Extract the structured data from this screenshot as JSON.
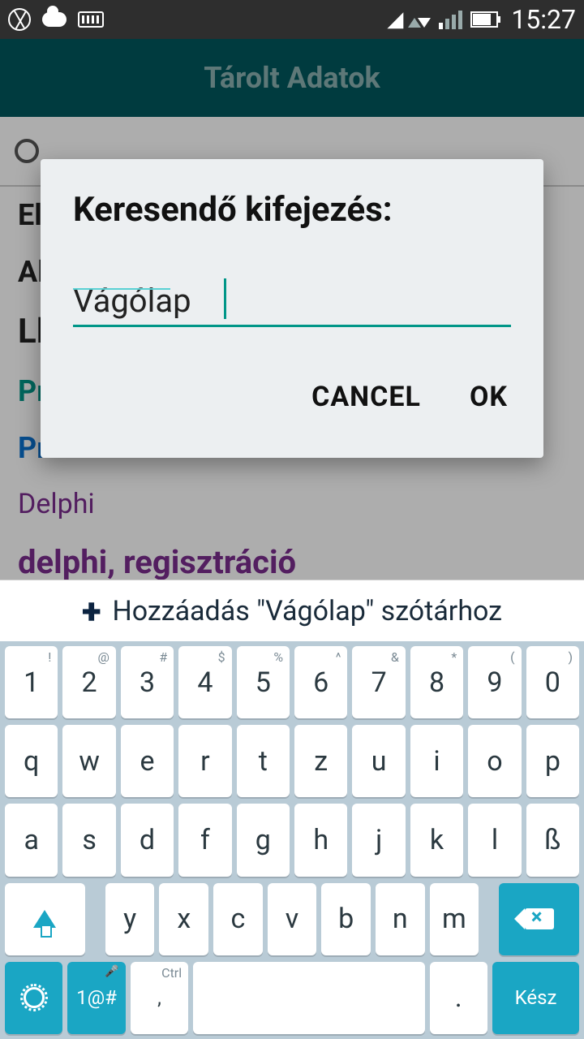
{
  "status": {
    "time": "15:27"
  },
  "header": {
    "title": "Tárolt Adatok"
  },
  "list": {
    "items": [
      "El",
      "Al",
      "Ll",
      "Pr",
      "Pr",
      "Delphi",
      "delphi, regisztráció"
    ]
  },
  "dialog": {
    "title": "Keresendő kifejezés:",
    "input_value": "Vágólap",
    "cancel_label": "CANCEL",
    "ok_label": "OK"
  },
  "suggestion": {
    "text": "Hozzáadás \"Vágólap\" szótárhoz"
  },
  "keyboard": {
    "row1": [
      {
        "k": "1",
        "s": "!"
      },
      {
        "k": "2",
        "s": "@"
      },
      {
        "k": "3",
        "s": "#"
      },
      {
        "k": "4",
        "s": "$"
      },
      {
        "k": "5",
        "s": "%"
      },
      {
        "k": "6",
        "s": "^"
      },
      {
        "k": "7",
        "s": "&"
      },
      {
        "k": "8",
        "s": "*"
      },
      {
        "k": "9",
        "s": "("
      },
      {
        "k": "0",
        "s": ")"
      }
    ],
    "row2": [
      "q",
      "w",
      "e",
      "r",
      "t",
      "z",
      "u",
      "i",
      "o",
      "p"
    ],
    "row3": [
      "a",
      "s",
      "d",
      "f",
      "g",
      "h",
      "j",
      "k",
      "l",
      "ß"
    ],
    "row4_letters": [
      "y",
      "x",
      "c",
      "v",
      "b",
      "n",
      "m"
    ],
    "bottom": {
      "alt": "1@#",
      "ctrl": "Ctrl",
      "comma": ",",
      "space": "",
      "dot": ".",
      "done": "Kész"
    }
  }
}
